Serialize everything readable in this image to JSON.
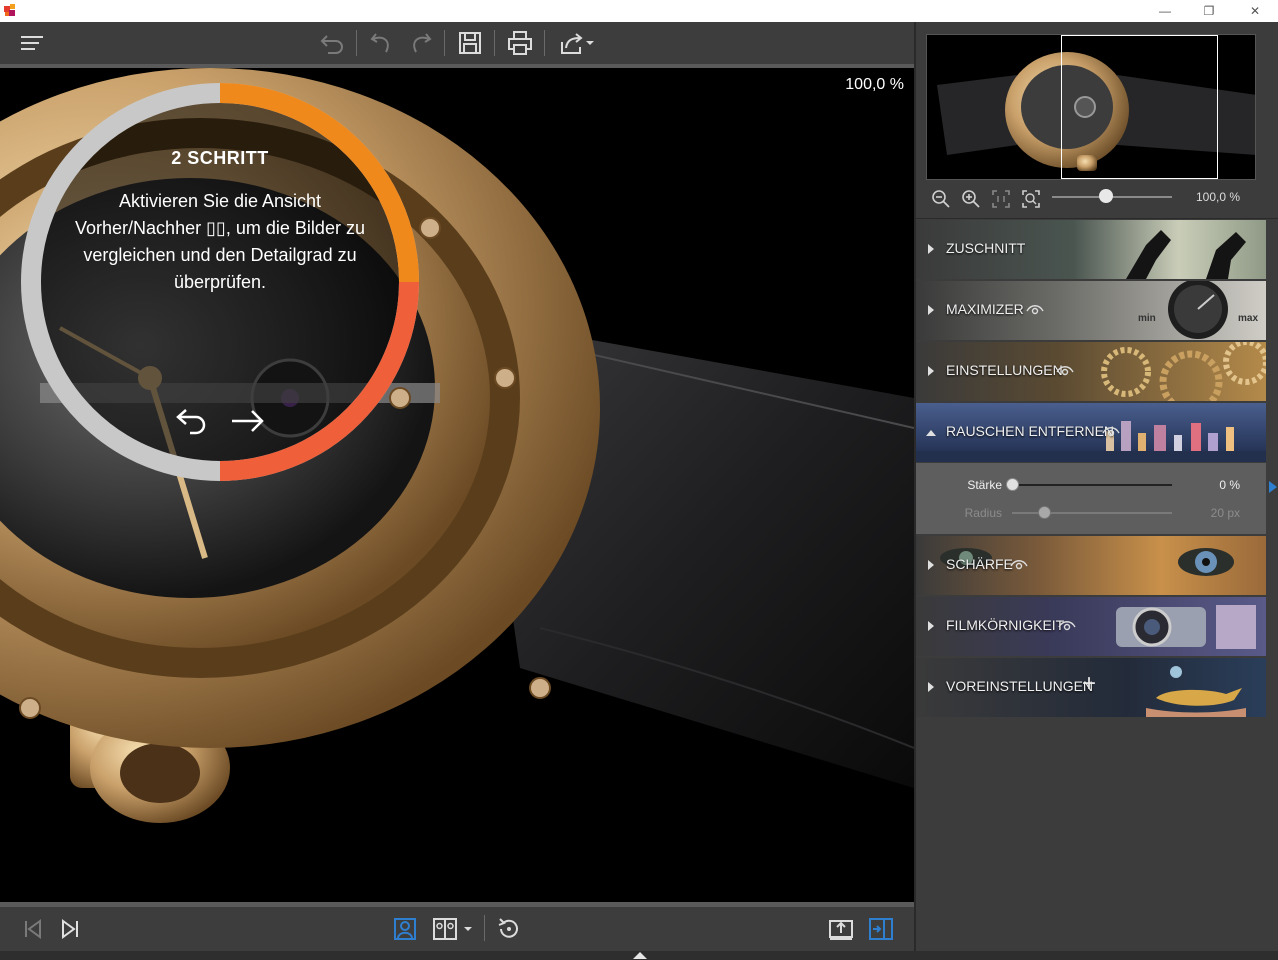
{
  "window": {
    "controls": {
      "minimize": "—",
      "restore": "❐",
      "close": "✕"
    }
  },
  "toolbar": {
    "icons": [
      "menu-icon",
      "undo-all-icon",
      "undo-icon",
      "redo-icon",
      "save-icon",
      "print-icon",
      "share-icon",
      "chevron-down-icon"
    ]
  },
  "viewer": {
    "zoom": "100,0 %"
  },
  "tutorial": {
    "step_title": "2  SCHRITT",
    "text": "Aktivieren Sie die Ansicht Vorher/Nachher ▯▯, um die Bilder zu vergleichen und den Detailgrad zu überprüfen.",
    "progress": 0.5,
    "colors": {
      "track": "#c8c8c8",
      "progress_top": "#f0891c",
      "progress_bottom": "#ee5f3a"
    }
  },
  "navigator": {
    "zoom_value": "100,0 %",
    "zoom_slider_position": 0.45
  },
  "sections": [
    {
      "label": "ZUSCHNITT",
      "eye": false,
      "open": false
    },
    {
      "label": "MAXIMIZER",
      "eye": true,
      "open": false,
      "dial_min": "min",
      "dial_max": "max"
    },
    {
      "label": "EINSTELLUNGEN",
      "eye": true,
      "open": false
    },
    {
      "label": "RAUSCHEN ENTFERNEN",
      "eye": true,
      "open": true
    },
    {
      "label": "SCHÄRFE",
      "eye": true,
      "open": false
    },
    {
      "label": "FILMKÖRNIGKEIT",
      "eye": true,
      "open": false
    },
    {
      "label": "VOREINSTELLUNGEN",
      "eye": false,
      "open": false,
      "plus": "+"
    }
  ],
  "noise": {
    "strength": {
      "label": "Stärke",
      "value": "0 %",
      "level": 0
    },
    "radius": {
      "label": "Radius",
      "value": "20 px",
      "level": 0.2
    }
  },
  "bottombar": {
    "icons": [
      "first-image-icon",
      "last-image-icon",
      "single-view-icon",
      "before-after-icon",
      "chevron-down-icon",
      "rotate-icon",
      "export-icon",
      "panel-toggle-icon"
    ],
    "accent": "#2f7fd1"
  }
}
